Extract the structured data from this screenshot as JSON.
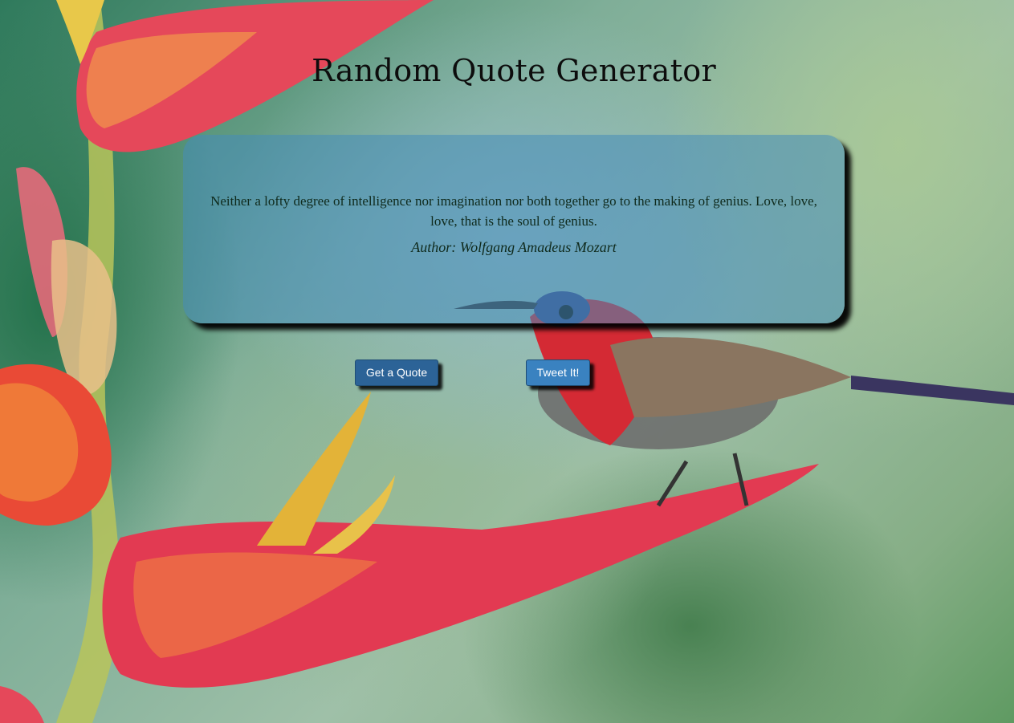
{
  "page": {
    "title": "Random Quote Generator"
  },
  "quote": {
    "text": "Neither a lofty degree of intelligence nor imagination nor both together go to the making of genius. Love, love, love, that is the soul of genius.",
    "author": "Author: Wolfgang Amadeus Mozart"
  },
  "buttons": {
    "get_quote_label": "Get a Quote",
    "tweet_label": "Tweet It!"
  },
  "colors": {
    "title_text": "#0d0d0d",
    "quote_box": "#468cb9",
    "get_quote_button": "#2c6397",
    "tweet_button": "#3a82c0",
    "button_text": "#ffffff"
  }
}
